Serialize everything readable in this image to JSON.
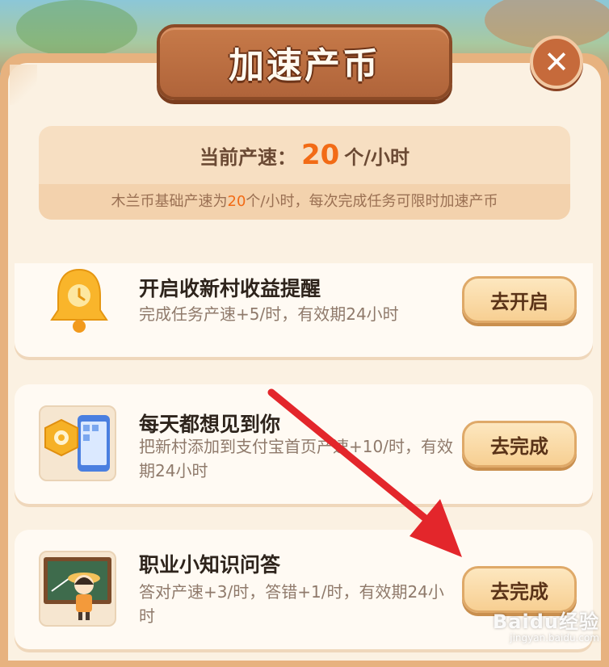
{
  "dialog": {
    "title": "加速产币",
    "close_label": "✕"
  },
  "speed": {
    "label": "当前产速：",
    "value": "20",
    "unit": "个/小时",
    "note_before": "木兰币基础产速为",
    "note_value": "20",
    "note_after": "个/小时，每次完成任务可限时加速产币"
  },
  "tasks": [
    {
      "title": "开启收新村收益提醒",
      "desc": "完成任务产速+5/时，有效期24小时",
      "button": "去开启",
      "icon": "bell-icon"
    },
    {
      "title": "每天都想见到你",
      "desc": "把新村添加到支付宝首页产速+10/时，有效期24小时",
      "button": "去完成",
      "icon": "phone-flower-icon"
    },
    {
      "title": "职业小知识问答",
      "desc": "答对产速+3/时，答错+1/时，有效期24小时",
      "button": "去完成",
      "icon": "teacher-icon"
    }
  ],
  "watermark": {
    "main": "Baidu经验",
    "sub": "jingyan.baidu.com"
  },
  "colors": {
    "accent": "#f26b16",
    "panel": "#e7b27f",
    "plank": "#b0643a",
    "button": "#f7cf92",
    "arrow": "#e3262b"
  }
}
